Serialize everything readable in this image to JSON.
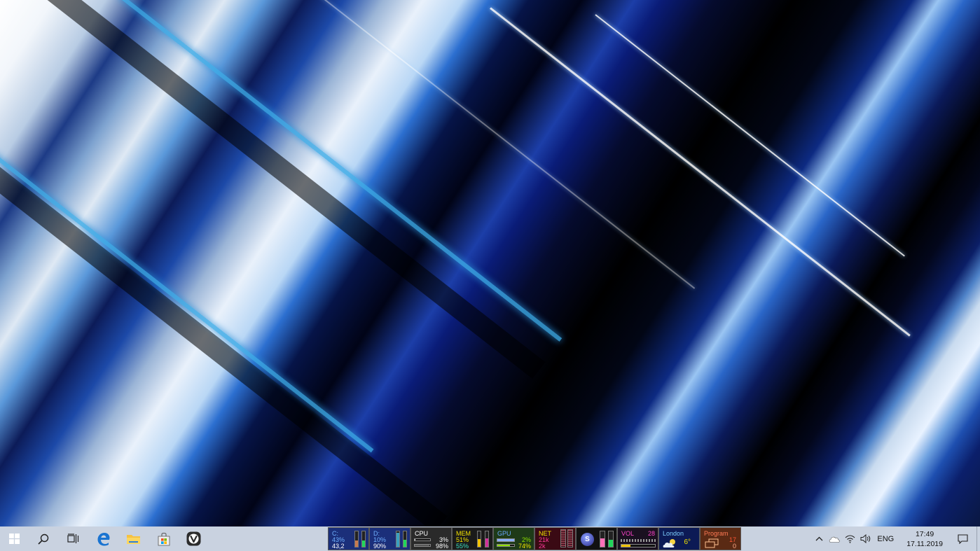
{
  "taskbar": {
    "apps": [
      {
        "name": "start-button",
        "icon": "windows-logo-icon"
      },
      {
        "name": "search-button",
        "icon": "search-icon"
      },
      {
        "name": "task-view-button",
        "icon": "task-view-icon"
      },
      {
        "name": "edge-button",
        "icon": "edge-icon"
      },
      {
        "name": "file-explorer-button",
        "icon": "folder-icon"
      },
      {
        "name": "store-button",
        "icon": "store-icon"
      },
      {
        "name": "vivaldi-button",
        "icon": "vivaldi-icon"
      }
    ]
  },
  "widgets": {
    "drive_c": {
      "label": "C:",
      "pct": "43%",
      "size": "43,2",
      "color": "#3a8cff",
      "fill": 0.43
    },
    "drive_d": {
      "label": "D:",
      "pct": "10%",
      "size": "90%",
      "color": "#3a8cff",
      "fill": 0.9
    },
    "cpu": {
      "label": "CPU",
      "value1": "3%",
      "value2": "98%",
      "fill": 0.03
    },
    "mem": {
      "label": "MEM",
      "value1": "51%",
      "value2": "55%",
      "color": "#f2e200",
      "fill": 0.51
    },
    "gpu": {
      "label": "GPU",
      "value1": "2%",
      "value2": "74%",
      "color": "#8fe000",
      "fill": 0.74
    },
    "net": {
      "label": "NET",
      "value1": "21k",
      "value2": "2k",
      "color": "#ff3a9a"
    },
    "vol": {
      "label": "VOL",
      "value": "28",
      "color": "#ff44cc",
      "fill": 0.28
    },
    "weather": {
      "city": "London",
      "temp": "6°",
      "icon": "cloud-sun-icon"
    },
    "program": {
      "label": "Program",
      "value1": "17",
      "value2": "0",
      "color": "#ff5533"
    }
  },
  "tray": {
    "language": "ENG",
    "time": "17:49",
    "date": "17.11.2019",
    "icons": [
      "chevron-up-icon",
      "onedrive-icon",
      "wifi-icon",
      "speaker-icon"
    ]
  }
}
